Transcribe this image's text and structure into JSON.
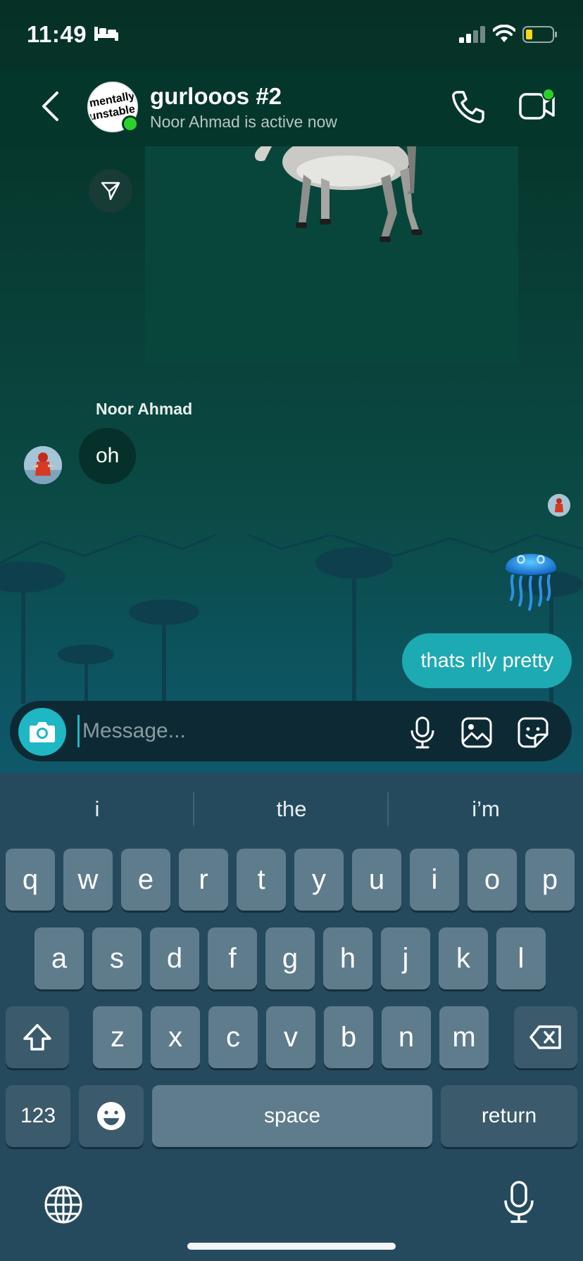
{
  "status_bar": {
    "time": "11:49",
    "battery_color": "#f5d916"
  },
  "header": {
    "title": "gurlooos #2",
    "subtitle": "Noor Ahmad is active now",
    "avatar_text_line1": "mentally",
    "avatar_text_line2": "unstable"
  },
  "messages": {
    "sender_name": "Noor Ahmad",
    "received_text": "oh",
    "sent_text": "thats rlly pretty"
  },
  "composer": {
    "placeholder": "Message..."
  },
  "keyboard": {
    "suggestions": [
      "i",
      "the",
      "i’m"
    ],
    "row1": [
      "q",
      "w",
      "e",
      "r",
      "t",
      "y",
      "u",
      "i",
      "o",
      "p"
    ],
    "row2": [
      "a",
      "s",
      "d",
      "f",
      "g",
      "h",
      "j",
      "k",
      "l"
    ],
    "row3": [
      "z",
      "x",
      "c",
      "v",
      "b",
      "n",
      "m"
    ],
    "numbers_label": "123",
    "space_label": "space",
    "return_label": "return"
  },
  "colors": {
    "accent": "#1eb7c3",
    "sent_bubble": "#1eaab2",
    "online": "#2bd12b"
  }
}
